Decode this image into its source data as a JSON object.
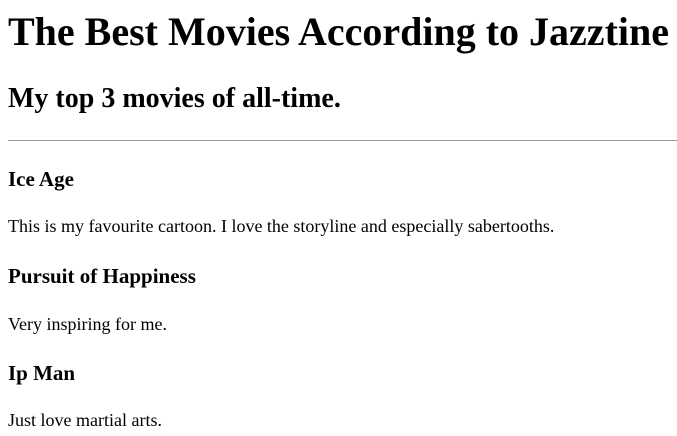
{
  "page": {
    "title": "The Best Movies According to Jazztine",
    "subtitle": "My top 3 movies of all-time."
  },
  "movies": [
    {
      "title": "Ice Age",
      "description": "This is my favourite cartoon. I love the storyline and especially sabertooths."
    },
    {
      "title": "Pursuit of Happiness",
      "description": "Very inspiring for me."
    },
    {
      "title": "Ip Man",
      "description": "Just love martial arts."
    }
  ]
}
